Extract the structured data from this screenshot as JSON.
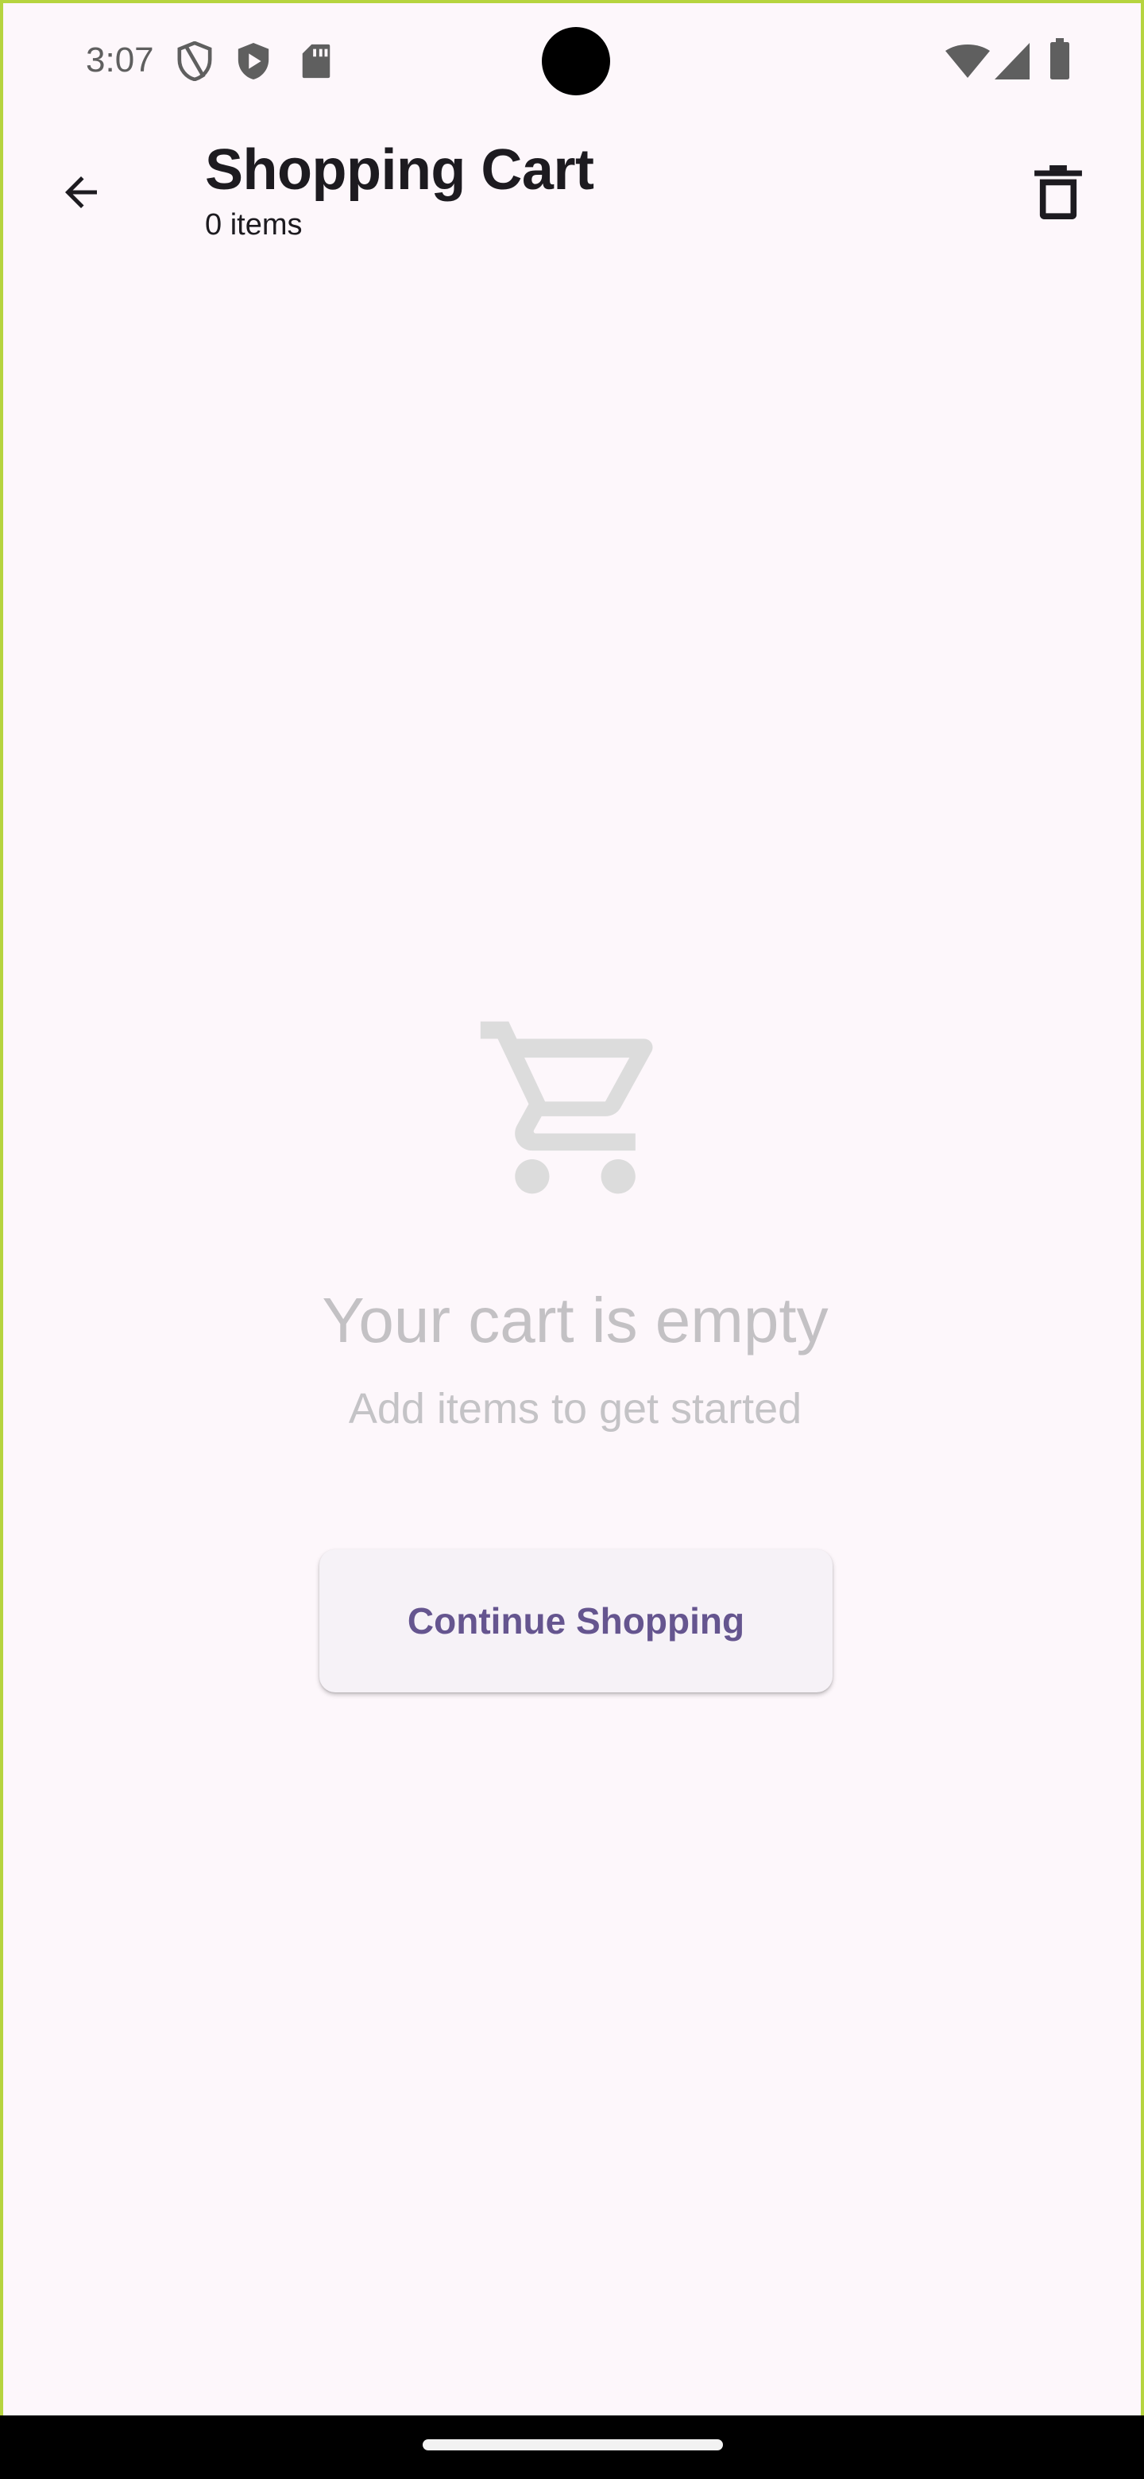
{
  "status_bar": {
    "time": "3:07",
    "left_icons": [
      "shield-icon",
      "play-shield-icon",
      "sd-card-icon"
    ],
    "right_icons": [
      "wifi-icon",
      "cellular-signal-icon",
      "battery-icon"
    ]
  },
  "app_bar": {
    "back_icon": "arrow-back-icon",
    "title": "Shopping Cart",
    "subtitle": "0 items",
    "action_icon": "delete-icon"
  },
  "empty_state": {
    "icon": "shopping-cart-icon",
    "title": "Your cart is empty",
    "subtitle": "Add items to get started",
    "button_label": "Continue Shopping"
  },
  "colors": {
    "background": "#fdf7fb",
    "accent": "#65558f",
    "muted_text": "#c3c1c4",
    "frame_border": "#b6d43f"
  }
}
